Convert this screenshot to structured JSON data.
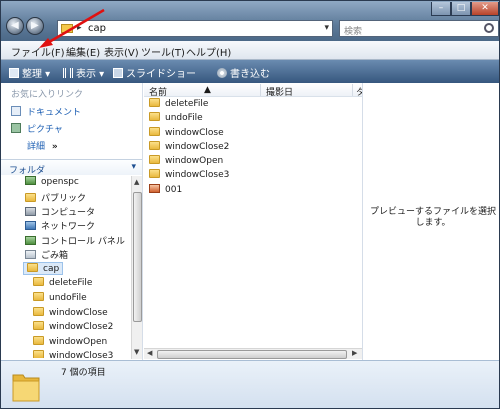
{
  "window": {
    "address_path": "cap",
    "search_placeholder": "検索",
    "nav_back": "◀",
    "nav_forward": "▶",
    "min": "–",
    "max": "□",
    "close": "✕"
  },
  "menu": [
    {
      "label": "ファイル(F)"
    },
    {
      "label": "編集(E)"
    },
    {
      "label": "表示(V)"
    },
    {
      "label": "ツール(T)"
    },
    {
      "label": "ヘルプ(H)"
    }
  ],
  "commands": [
    {
      "label": "整理",
      "icon": "organize-icon"
    },
    {
      "label": "表示",
      "icon": "views-icon"
    },
    {
      "label": "スライドショー",
      "icon": "slideshow-icon"
    },
    {
      "label": "書き込む",
      "icon": "burn-icon"
    }
  ],
  "favorites": {
    "title": "お気に入りリンク",
    "items": [
      {
        "label": "ドキュメント",
        "icon": "documents-icon"
      },
      {
        "label": "ピクチャ",
        "icon": "pictures-icon"
      }
    ],
    "more": "詳細",
    "more_chevron": "»"
  },
  "folders": {
    "title": "フォルダ",
    "chevron": "▾",
    "tree": [
      {
        "label": "openspc",
        "icon": "program-icon"
      },
      {
        "label": "パブリック",
        "icon": "folder-icon"
      },
      {
        "label": "コンピュータ",
        "icon": "computer-icon"
      },
      {
        "label": "ネットワーク",
        "icon": "network-icon"
      },
      {
        "label": "コントロール パネル",
        "icon": "control-panel-icon"
      },
      {
        "label": "ごみ箱",
        "icon": "recycle-bin-icon"
      },
      {
        "label": "cap",
        "icon": "folder-icon",
        "selected": true
      },
      {
        "label": "deleteFile",
        "icon": "folder-icon"
      },
      {
        "label": "undoFile",
        "icon": "folder-icon"
      },
      {
        "label": "windowClose",
        "icon": "folder-icon"
      },
      {
        "label": "windowClose2",
        "icon": "folder-icon"
      },
      {
        "label": "windowOpen",
        "icon": "folder-icon"
      },
      {
        "label": "windowClose3",
        "icon": "folder-icon"
      }
    ]
  },
  "columns": {
    "name": "名前",
    "date_taken": "撮影日",
    "tags": "タ"
  },
  "files": [
    {
      "name": "deleteFile",
      "icon": "folder-icon"
    },
    {
      "name": "undoFile",
      "icon": "folder-icon"
    },
    {
      "name": "windowClose",
      "icon": "folder-icon"
    },
    {
      "name": "windowClose2",
      "icon": "folder-icon"
    },
    {
      "name": "windowOpen",
      "icon": "folder-icon"
    },
    {
      "name": "windowClose3",
      "icon": "folder-icon"
    },
    {
      "name": "001",
      "icon": "image-file-icon"
    }
  ],
  "preview": {
    "message": "プレビューするファイルを選択します。"
  },
  "status": {
    "count_text": "7 個の項目"
  },
  "colors": {
    "accent": "#1d5fb3",
    "annotation_arrow": "#e01010"
  }
}
